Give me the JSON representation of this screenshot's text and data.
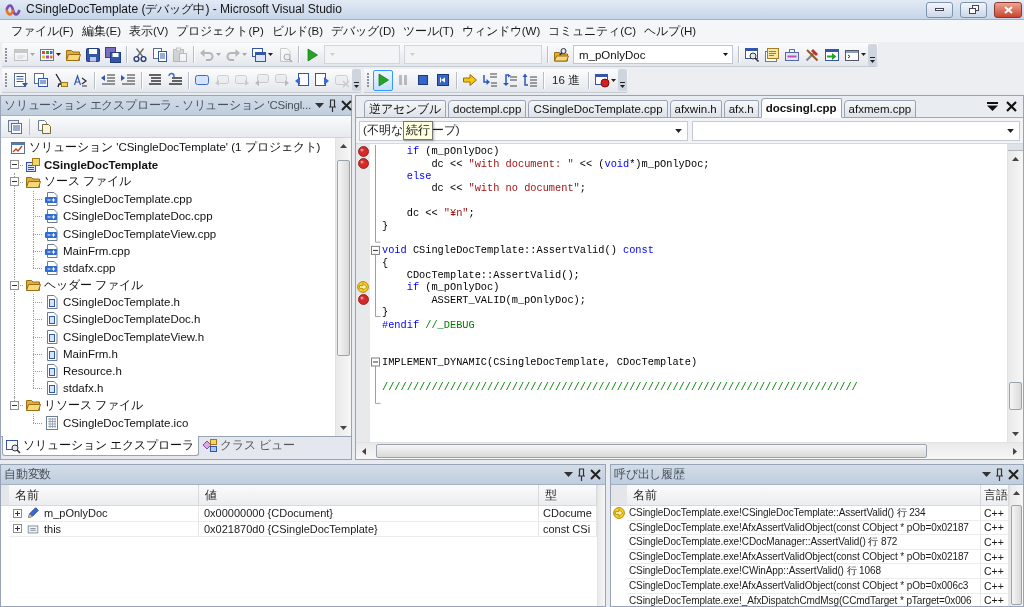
{
  "window": {
    "title": "CSingleDocTemplate (デバッグ中) - Microsoft Visual Studio"
  },
  "menu": [
    "ファイル(F)",
    "編集(E)",
    "表示(V)",
    "プロジェクト(P)",
    "ビルド(B)",
    "デバッグ(D)",
    "ツール(T)",
    "ウィンドウ(W)",
    "コミュニティ(C)",
    "ヘルプ(H)"
  ],
  "standard_toolbar": {
    "groups": [
      [
        {
          "kind": "button",
          "disabled": true,
          "highlighted": false,
          "menu": true
        },
        {
          "kind": "button",
          "disabled": false,
          "highlighted": false,
          "menu": true
        },
        {
          "kind": "button",
          "disabled": false,
          "highlighted": false,
          "menu": false
        },
        {
          "kind": "button",
          "disabled": false,
          "highlighted": false,
          "menu": false
        },
        {
          "kind": "button",
          "disabled": false,
          "highlighted": false,
          "menu": false
        }
      ],
      [
        {
          "kind": "button",
          "disabled": false,
          "highlighted": false,
          "menu": false
        },
        {
          "kind": "button",
          "disabled": false,
          "highlighted": false,
          "menu": false
        },
        {
          "kind": "button",
          "disabled": true,
          "highlighted": false,
          "menu": false
        }
      ],
      [
        {
          "kind": "button",
          "disabled": true,
          "highlighted": false,
          "menu": true
        },
        {
          "kind": "button",
          "disabled": true,
          "highlighted": false,
          "menu": true
        },
        {
          "kind": "button",
          "disabled": false,
          "highlighted": false,
          "menu": true
        },
        {
          "kind": "button",
          "disabled": true,
          "highlighted": false,
          "menu": false
        }
      ],
      [
        {
          "kind": "button",
          "disabled": false,
          "highlighted": false,
          "menu": false
        },
        {
          "kind": "combo",
          "disabled": true
        },
        {
          "kind": "combo",
          "disabled": true
        }
      ],
      [
        {
          "kind": "button",
          "disabled": false,
          "highlighted": false,
          "menu": false
        },
        {
          "kind": "combo",
          "disabled": false,
          "value": "m_pOnlyDoc"
        }
      ],
      [
        {
          "kind": "button",
          "disabled": false,
          "highlighted": false,
          "menu": false
        },
        {
          "kind": "button",
          "disabled": false,
          "highlighted": false,
          "menu": false
        },
        {
          "kind": "button",
          "disabled": false,
          "highlighted": false,
          "menu": false
        },
        {
          "kind": "button",
          "disabled": false,
          "highlighted": false,
          "menu": false
        },
        {
          "kind": "button",
          "disabled": false,
          "highlighted": false,
          "menu": false
        },
        {
          "kind": "button",
          "disabled": false,
          "highlighted": false,
          "menu": true
        }
      ]
    ]
  },
  "text_editor_toolbar": {
    "groups": [
      [
        {
          "kind": "button",
          "disabled": false,
          "highlighted": false,
          "menu": false
        },
        {
          "kind": "button",
          "disabled": false,
          "highlighted": false,
          "menu": false
        },
        {
          "kind": "button",
          "disabled": false,
          "highlighted": false,
          "menu": false
        },
        {
          "kind": "button",
          "disabled": false,
          "highlighted": false,
          "menu": false
        }
      ],
      [
        {
          "kind": "button",
          "disabled": false,
          "highlighted": false,
          "menu": false
        },
        {
          "kind": "button",
          "disabled": false,
          "highlighted": false,
          "menu": false
        }
      ],
      [
        {
          "kind": "button",
          "disabled": false,
          "highlighted": false,
          "menu": false
        },
        {
          "kind": "button",
          "disabled": false,
          "highlighted": false,
          "menu": false
        }
      ],
      [
        {
          "kind": "button",
          "disabled": false,
          "highlighted": false,
          "menu": false
        },
        {
          "kind": "button",
          "disabled": true,
          "highlighted": false,
          "menu": false
        },
        {
          "kind": "button",
          "disabled": true,
          "highlighted": false,
          "menu": false
        },
        {
          "kind": "button",
          "disabled": true,
          "highlighted": false,
          "menu": false
        },
        {
          "kind": "button",
          "disabled": true,
          "highlighted": false,
          "menu": false
        },
        {
          "kind": "button",
          "disabled": false,
          "highlighted": false,
          "menu": false
        },
        {
          "kind": "button",
          "disabled": false,
          "highlighted": false,
          "menu": false
        },
        {
          "kind": "button",
          "disabled": true,
          "highlighted": false,
          "menu": false
        }
      ]
    ]
  },
  "debug_toolbar": {
    "groups": [
      [
        {
          "kind": "button",
          "disabled": false,
          "highlighted": true,
          "menu": false
        },
        {
          "kind": "button",
          "disabled": true,
          "highlighted": false,
          "menu": false
        },
        {
          "kind": "button",
          "disabled": false,
          "highlighted": false,
          "menu": false
        },
        {
          "kind": "button",
          "disabled": false,
          "highlighted": false,
          "menu": false
        }
      ],
      [
        {
          "kind": "button",
          "disabled": false,
          "highlighted": false,
          "menu": false
        },
        {
          "kind": "button",
          "disabled": false,
          "highlighted": false,
          "menu": false
        },
        {
          "kind": "button",
          "disabled": false,
          "highlighted": false,
          "menu": false
        },
        {
          "kind": "button",
          "disabled": false,
          "highlighted": false,
          "menu": false
        }
      ],
      [
        {
          "kind": "text",
          "label": "16 進",
          "disabled": false,
          "highlighted": false
        }
      ],
      [
        {
          "kind": "button",
          "disabled": false,
          "highlighted": false,
          "menu": true
        }
      ]
    ],
    "tooltip": "続行"
  },
  "solution_explorer": {
    "title": "ソリューション エクスプローラ - ソリューション 'CSingl...",
    "tree": [
      {
        "label": "ソリューション 'CSingleDocTemplate' (1 プロジェクト)",
        "kind": "solution",
        "children": [
          {
            "label": "CSingleDocTemplate",
            "kind": "project",
            "expanded": true,
            "children": [
              {
                "label": "ソース ファイル",
                "kind": "folder",
                "expanded": true,
                "children": [
                  {
                    "label": "CSingleDocTemplate.cpp",
                    "kind": "source"
                  },
                  {
                    "label": "CSingleDocTemplateDoc.cpp",
                    "kind": "source"
                  },
                  {
                    "label": "CSingleDocTemplateView.cpp",
                    "kind": "source"
                  },
                  {
                    "label": "MainFrm.cpp",
                    "kind": "source"
                  },
                  {
                    "label": "stdafx.cpp",
                    "kind": "source"
                  }
                ]
              },
              {
                "label": "ヘッダー ファイル",
                "kind": "folder",
                "expanded": true,
                "children": [
                  {
                    "label": "CSingleDocTemplate.h",
                    "kind": "header"
                  },
                  {
                    "label": "CSingleDocTemplateDoc.h",
                    "kind": "header"
                  },
                  {
                    "label": "CSingleDocTemplateView.h",
                    "kind": "header"
                  },
                  {
                    "label": "MainFrm.h",
                    "kind": "header"
                  },
                  {
                    "label": "Resource.h",
                    "kind": "header"
                  },
                  {
                    "label": "stdafx.h",
                    "kind": "header"
                  }
                ]
              },
              {
                "label": "リソース ファイル",
                "kind": "folder",
                "expanded": true,
                "children": [
                  {
                    "label": "CSingleDocTemplate.ico",
                    "kind": "resource"
                  }
                ]
              }
            ]
          }
        ]
      }
    ],
    "tabs": [
      {
        "label": "ソリューション エクスプローラ",
        "selected": true
      },
      {
        "label": "クラス ビュー",
        "selected": false
      }
    ]
  },
  "editor": {
    "tabs": [
      {
        "label": "逆アセンブル",
        "selected": false
      },
      {
        "label": "doctempl.cpp",
        "selected": false
      },
      {
        "label": "CSingleDocTemplate.cpp",
        "selected": false
      },
      {
        "label": "afxwin.h",
        "selected": false
      },
      {
        "label": "afx.h",
        "selected": false
      },
      {
        "label": "docsingl.cpp",
        "selected": true
      },
      {
        "label": "afxmem.cpp",
        "selected": false
      }
    ],
    "scope_dropdown": {
      "value_start": "(不明な",
      "value_end": "ープ)"
    },
    "lines": [
      {
        "kind": "body",
        "breakpoint": true,
        "current": false,
        "tokens": [
          {
            "kind": "keyword",
            "text": "    if"
          },
          {
            "kind": "plain",
            "text": " (m_pOnlyDoc)"
          }
        ]
      },
      {
        "kind": "body",
        "breakpoint": true,
        "current": false,
        "tokens": [
          {
            "kind": "plain",
            "text": "        dc << "
          },
          {
            "kind": "string",
            "text": "\"with document: \""
          },
          {
            "kind": "plain",
            "text": " << ("
          },
          {
            "kind": "keyword",
            "text": "void"
          },
          {
            "kind": "plain",
            "text": "*)m_pOnlyDoc;"
          }
        ]
      },
      {
        "kind": "body",
        "breakpoint": false,
        "current": false,
        "tokens": [
          {
            "kind": "keyword",
            "text": "    else"
          }
        ]
      },
      {
        "kind": "body",
        "breakpoint": false,
        "current": false,
        "tokens": [
          {
            "kind": "plain",
            "text": "        dc << "
          },
          {
            "kind": "string",
            "text": "\"with no document\""
          },
          {
            "kind": "plain",
            "text": ";"
          }
        ]
      },
      {
        "kind": "body",
        "breakpoint": false,
        "current": false
      },
      {
        "kind": "body",
        "breakpoint": false,
        "current": false,
        "tokens": [
          {
            "kind": "plain",
            "text": "    dc << "
          },
          {
            "kind": "string",
            "text": "\"¥n\""
          },
          {
            "kind": "plain",
            "text": ";"
          }
        ]
      },
      {
        "kind": "body",
        "breakpoint": false,
        "current": false,
        "tokens": [
          {
            "kind": "plain",
            "text": "}"
          }
        ]
      },
      {
        "kind": "end",
        "breakpoint": false,
        "current": false
      },
      {
        "kind": "start",
        "breakpoint": false,
        "current": false,
        "tokens": [
          {
            "kind": "keyword",
            "text": "void"
          },
          {
            "kind": "plain",
            "text": " CSingleDocTemplate::AssertValid() "
          },
          {
            "kind": "keyword",
            "text": "const"
          }
        ]
      },
      {
        "kind": "body",
        "breakpoint": false,
        "current": false,
        "tokens": [
          {
            "kind": "plain",
            "text": "{"
          }
        ]
      },
      {
        "kind": "body",
        "breakpoint": false,
        "current": false,
        "tokens": [
          {
            "kind": "plain",
            "text": "    CDocTemplate::AssertValid();"
          }
        ]
      },
      {
        "kind": "body",
        "breakpoint": false,
        "current": true,
        "tokens": [
          {
            "kind": "keyword",
            "text": "    if"
          },
          {
            "kind": "plain",
            "text": " (m_pOnlyDoc)"
          }
        ]
      },
      {
        "kind": "body",
        "breakpoint": true,
        "current": false,
        "tokens": [
          {
            "kind": "plain",
            "text": "        ASSERT_VALID(m_pOnlyDoc);"
          }
        ]
      },
      {
        "kind": "end",
        "breakpoint": false,
        "current": false,
        "tokens": [
          {
            "kind": "plain",
            "text": "}"
          }
        ]
      },
      {
        "kind": "plain",
        "breakpoint": false,
        "current": false,
        "tokens": [
          {
            "kind": "preprocessor",
            "text": "#endif"
          },
          {
            "kind": "comment",
            "text": " //_DEBUG"
          }
        ]
      },
      {
        "kind": "plain",
        "breakpoint": false,
        "current": false
      },
      {
        "kind": "plain",
        "breakpoint": false,
        "current": false
      },
      {
        "kind": "start",
        "breakpoint": false,
        "current": false,
        "tokens": [
          {
            "kind": "plain",
            "text": "IMPLEMENT_DYNAMIC(CSingleDocTemplate, CDocTemplate)"
          }
        ]
      },
      {
        "kind": "body",
        "breakpoint": false,
        "current": false
      },
      {
        "kind": "body",
        "breakpoint": false,
        "current": false,
        "tokens": [
          {
            "kind": "comment",
            "text": "/////////////////////////////////////////////////////////////////////////////"
          }
        ]
      },
      {
        "kind": "end",
        "breakpoint": false,
        "current": false
      }
    ]
  },
  "autos": {
    "title": "自動変数",
    "columns": [
      "名前",
      "値",
      "型"
    ],
    "rows": [
      {
        "name": "m_pOnlyDoc",
        "value": "0x00000000 {CDocument}",
        "type": "CDocume",
        "kind": "field",
        "expanded": false
      },
      {
        "name": "this",
        "value": "0x021870d0 {CSingleDocTemplate}",
        "type": "const CSi",
        "kind": "local",
        "expanded": false
      }
    ]
  },
  "call_stack": {
    "title": "呼び出し履歴",
    "columns": [
      "名前",
      "言語"
    ],
    "rows": [
      {
        "name": "CSingleDocTemplate.exe!CSingleDocTemplate::AssertValid() 行 234",
        "language": "C++",
        "current": true
      },
      {
        "name": "CSingleDocTemplate.exe!AfxAssertValidObject(const CObject * pOb=0x02187",
        "language": "C++",
        "current": false
      },
      {
        "name": "CSingleDocTemplate.exe!CDocManager::AssertValid() 行 872",
        "language": "C++",
        "current": false
      },
      {
        "name": "CSingleDocTemplate.exe!AfxAssertValidObject(const CObject * pOb=0x02187",
        "language": "C++",
        "current": false
      },
      {
        "name": "CSingleDocTemplate.exe!CWinApp::AssertValid() 行 1068",
        "language": "C++",
        "current": false
      },
      {
        "name": "CSingleDocTemplate.exe!AfxAssertValidObject(const CObject * pOb=0x006c3",
        "language": "C++",
        "current": false
      },
      {
        "name": "CSingleDocTemplate.exe!_AfxDispatchCmdMsg(CCmdTarget * pTarget=0x006",
        "language": "C++",
        "current": false
      }
    ]
  }
}
